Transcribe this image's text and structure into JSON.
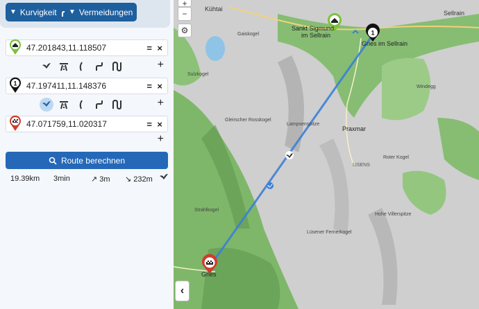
{
  "toolbar": {
    "curvy_label": "Kurvigkeit",
    "avoid_label": "Vermeidungen"
  },
  "waypoints": [
    {
      "marker": "home",
      "coord": "47.201843,11.118507"
    },
    {
      "marker": "1",
      "coord": "47.197411,11.148376"
    },
    {
      "marker": "finish",
      "coord": "47.071759,11.020317"
    }
  ],
  "route_button_label": "Route berechnen",
  "stats": {
    "distance": "19.39km",
    "duration": "3min",
    "ascent": "↗ 3m",
    "descent": "↘ 232m"
  },
  "map": {
    "labels": {
      "kuhtai": "Kühtai",
      "sellrain": "Sellrain",
      "sankt_sigmund": "Sankt Sigmund",
      "im_sellrain": "im Sellrain",
      "gries": "Gries im Sellrain",
      "praxmar": "Praxmar",
      "gries_bottom": "Gries",
      "lisens": "LISENS",
      "gaiskogel": "Gaiskogel",
      "sulzkogel": "Sulzkogel",
      "lampsenspitze": "Lampsenspitze",
      "rotergrubkogel": "Roter Kogel",
      "windegg": "Windegg",
      "strahlkogel": "Strahlkogel",
      "lusener": "Lüsener Fernerkogel",
      "hohe_villerspitze": "Hohe Villerspitze",
      "gleirscher": "Gleirscher Rosskogel"
    },
    "zoom_in": "+",
    "zoom_out": "−",
    "settings_icon": "gear-icon",
    "collapse": "‹"
  },
  "colors": {
    "primary": "#1e5f9e",
    "route": "#3b7fd6",
    "home_pin": "#7cc23d",
    "finish_pin": "#d23b2f"
  }
}
